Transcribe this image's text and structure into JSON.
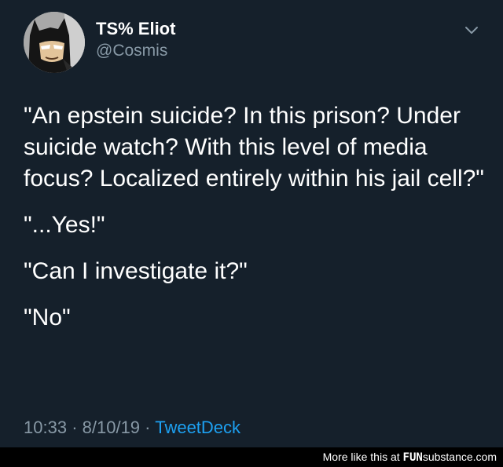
{
  "tweet": {
    "author": {
      "display_name": "TS% Eliot",
      "handle": "@Cosmis",
      "avatar_icon": "batman-cartoon-avatar"
    },
    "menu_icon": "chevron-down-icon",
    "paragraphs": [
      "\"An epstein suicide? In this prison? Under suicide watch? With this level of media focus? Localized entirely within his jail cell?\"",
      "\"...Yes!\"",
      "\"Can I investigate it?\"",
      "\"No\""
    ],
    "time": "10:33",
    "separator": "·",
    "date": "8/10/19",
    "source": "TweetDeck"
  },
  "footer": {
    "text": "More like this at",
    "brand_prefix": "FUN",
    "brand_suffix": "substance",
    "brand_tld": ".com"
  },
  "colors": {
    "background": "#15202b",
    "text": "#ffffff",
    "muted": "#8899a6",
    "link": "#1da1f2",
    "footer_bg": "#000000"
  }
}
